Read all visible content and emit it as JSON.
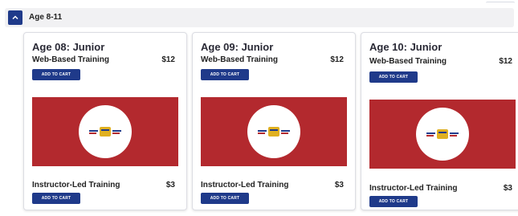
{
  "header": {
    "title": "Age 8-11"
  },
  "cart_button_label": "ADD TO CART",
  "cards": [
    {
      "title": "Age 08: Junior",
      "web": {
        "label": "Web-Based Training",
        "price": "$12"
      },
      "instructor": {
        "label": "Instructor-Led Training",
        "price": "$3"
      }
    },
    {
      "title": "Age 09: Junior",
      "web": {
        "label": "Web-Based Training",
        "price": "$12"
      },
      "instructor": {
        "label": "Instructor-Led Training",
        "price": "$3"
      }
    },
    {
      "title": "Age 10: Junior",
      "web": {
        "label": "Web-Based Training",
        "price": "$12"
      },
      "instructor": {
        "label": "Instructor-Led Training",
        "price": "$3"
      }
    }
  ],
  "colors": {
    "brand_blue": "#1f3a8a",
    "banner_red": "#b3292e",
    "logo_gold": "#e0b020"
  }
}
